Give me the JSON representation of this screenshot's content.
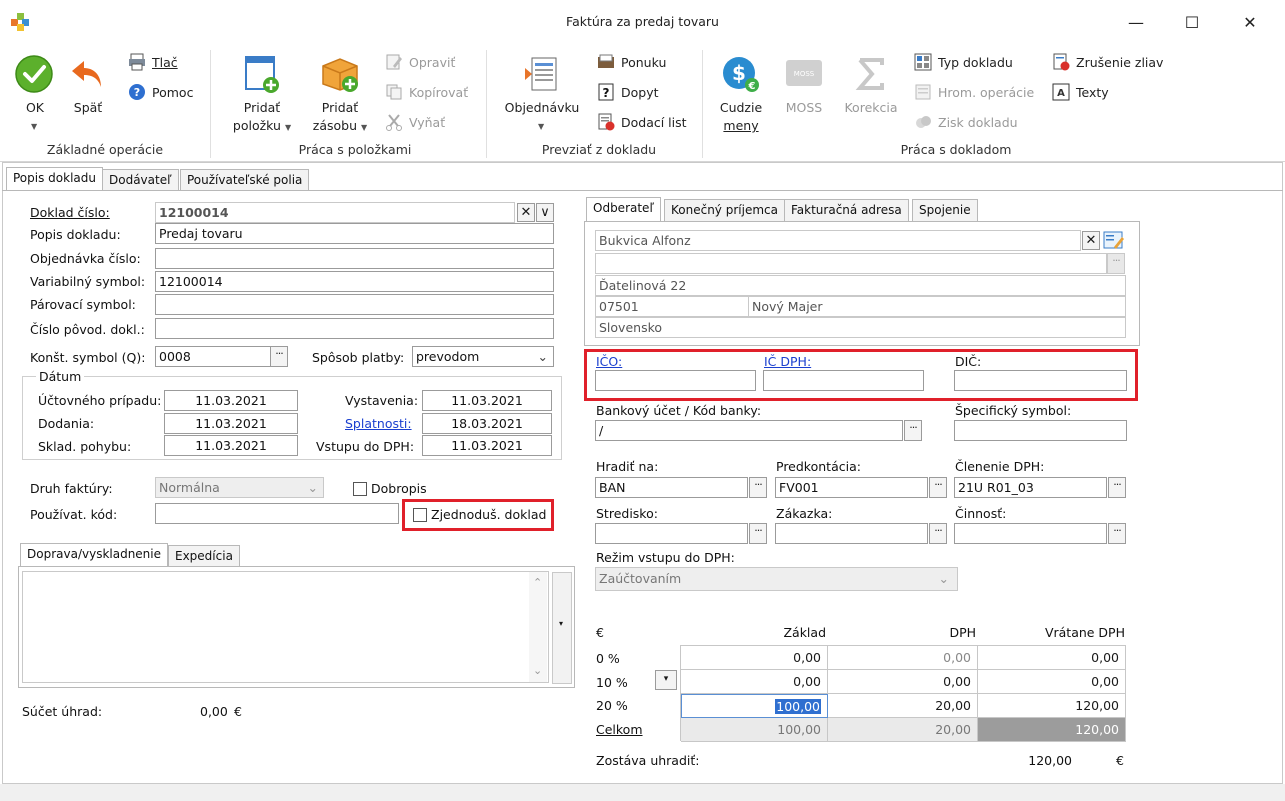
{
  "window": {
    "title": "Faktúra za predaj tovaru",
    "minimize": "—",
    "maximize": "☐",
    "close": "✕"
  },
  "ribbon": {
    "groups": {
      "basic": "Základné operácie",
      "items": "Práca s položkami",
      "convert": "Prevziať z dokladu",
      "document": "Práca s dokladom"
    },
    "ok": "OK",
    "back": "Späť",
    "print": "Tlač",
    "help": "Pomoc",
    "add_item_1": "Pridať",
    "add_item_2": "položku",
    "add_stock_1": "Pridať",
    "add_stock_2": "zásobu",
    "edit": "Opraviť",
    "copy": "Kopírovať",
    "cut": "Vyňať",
    "order": "Objednávku",
    "offer": "Ponuku",
    "inquiry": "Dopyt",
    "delivery": "Dodací list",
    "foreign_1": "Cudzie",
    "foreign_2": "meny",
    "moss": "MOSS",
    "correction": "Korekcia",
    "doc_type": "Typ dokladu",
    "bulk_ops": "Hrom. operácie",
    "profit": "Zisk dokladu",
    "cancel_disc": "Zrušenie zliav",
    "texts": "Texty"
  },
  "tabs": {
    "main": [
      "Popis dokladu",
      "Dodávateľ",
      "Používateľské polia"
    ],
    "partner": [
      "Odberateľ",
      "Konečný príjemca",
      "Fakturačná adresa",
      "Spojenie"
    ],
    "bottom": [
      "Doprava/vyskladnenie",
      "Expedícia"
    ]
  },
  "form": {
    "doc_no_label": "Doklad číslo:",
    "doc_no": "12100014",
    "desc_label": "Popis dokladu:",
    "desc": "Predaj tovaru",
    "order_no_label": "Objednávka číslo:",
    "order_no": "",
    "var_sym_label": "Variabilný symbol:",
    "var_sym": "12100014",
    "pair_sym_label": "Párovací symbol:",
    "pair_sym": "",
    "orig_doc_label": "Číslo pôvod. dokl.:",
    "orig_doc": "",
    "const_sym_label": "Konšt. symbol (Q):",
    "const_sym": "0008",
    "payment_label": "Spôsob platby:",
    "payment": "prevodom",
    "dates_legend": "Dátum",
    "acc_case_label": "Účtovného prípadu:",
    "acc_case": "11.03.2021",
    "delivery_label": "Dodania:",
    "delivery": "11.03.2021",
    "stock_label": "Sklad. pohybu:",
    "stock": "11.03.2021",
    "issue_label": "Vystavenia:",
    "issue": "11.03.2021",
    "due_label": "Splatnosti:",
    "due": "18.03.2021",
    "vat_entry_label": "Vstupu do DPH:",
    "vat_entry": "11.03.2021",
    "inv_type_label": "Druh faktúry:",
    "inv_type": "Normálna",
    "credit_note": "Dobropis",
    "user_code_label": "Používat. kód:",
    "user_code": "",
    "simplified": "Zjednoduš. doklad",
    "payments_label": "Súčet úhrad:",
    "payments_value": "0,00",
    "payments_currency": "€"
  },
  "partner": {
    "name": "Bukvica Alfonz",
    "line2": "",
    "street": "Ďatelinová 22",
    "zip": "07501",
    "city": "Nový Majer",
    "country": "Slovensko",
    "ico_label": "IČO:",
    "ic_dph_label": "IČ DPH:",
    "dic_label": "DIČ:",
    "ico": "",
    "ic_dph": "",
    "dic": "",
    "bank_label": "Bankový účet / Kód banky:",
    "bank": "/",
    "spec_sym_label": "Špecifický symbol:",
    "spec_sym": "",
    "pay_to_label": "Hradiť na:",
    "pay_to": "BAN",
    "precont_label": "Predkontácia:",
    "precont": "FV001",
    "vat_split_label": "Členenie DPH:",
    "vat_split": "21U R01_03",
    "center_label": "Stredisko:",
    "center": "",
    "contract_label": "Zákazka:",
    "contract": "",
    "activity_label": "Činnosť:",
    "activity": "",
    "vat_mode_label": "Režim vstupu do DPH:",
    "vat_mode": "Zaúčtovaním"
  },
  "totals": {
    "currency": "€",
    "col_base": "Základ",
    "col_vat": "DPH",
    "col_total": "Vrátane DPH",
    "rows": [
      {
        "rate": "0 %",
        "base": "0,00",
        "vat": "0,00",
        "total": "0,00"
      },
      {
        "rate": "10 %",
        "base": "0,00",
        "vat": "0,00",
        "total": "0,00"
      },
      {
        "rate": "20 %",
        "base": "100,00",
        "vat": "20,00",
        "total": "120,00"
      },
      {
        "rate": "Celkom",
        "base": "100,00",
        "vat": "20,00",
        "total": "120,00"
      }
    ],
    "remaining_label": "Zostáva uhradiť:",
    "remaining": "120,00",
    "remaining_currency": "€"
  }
}
